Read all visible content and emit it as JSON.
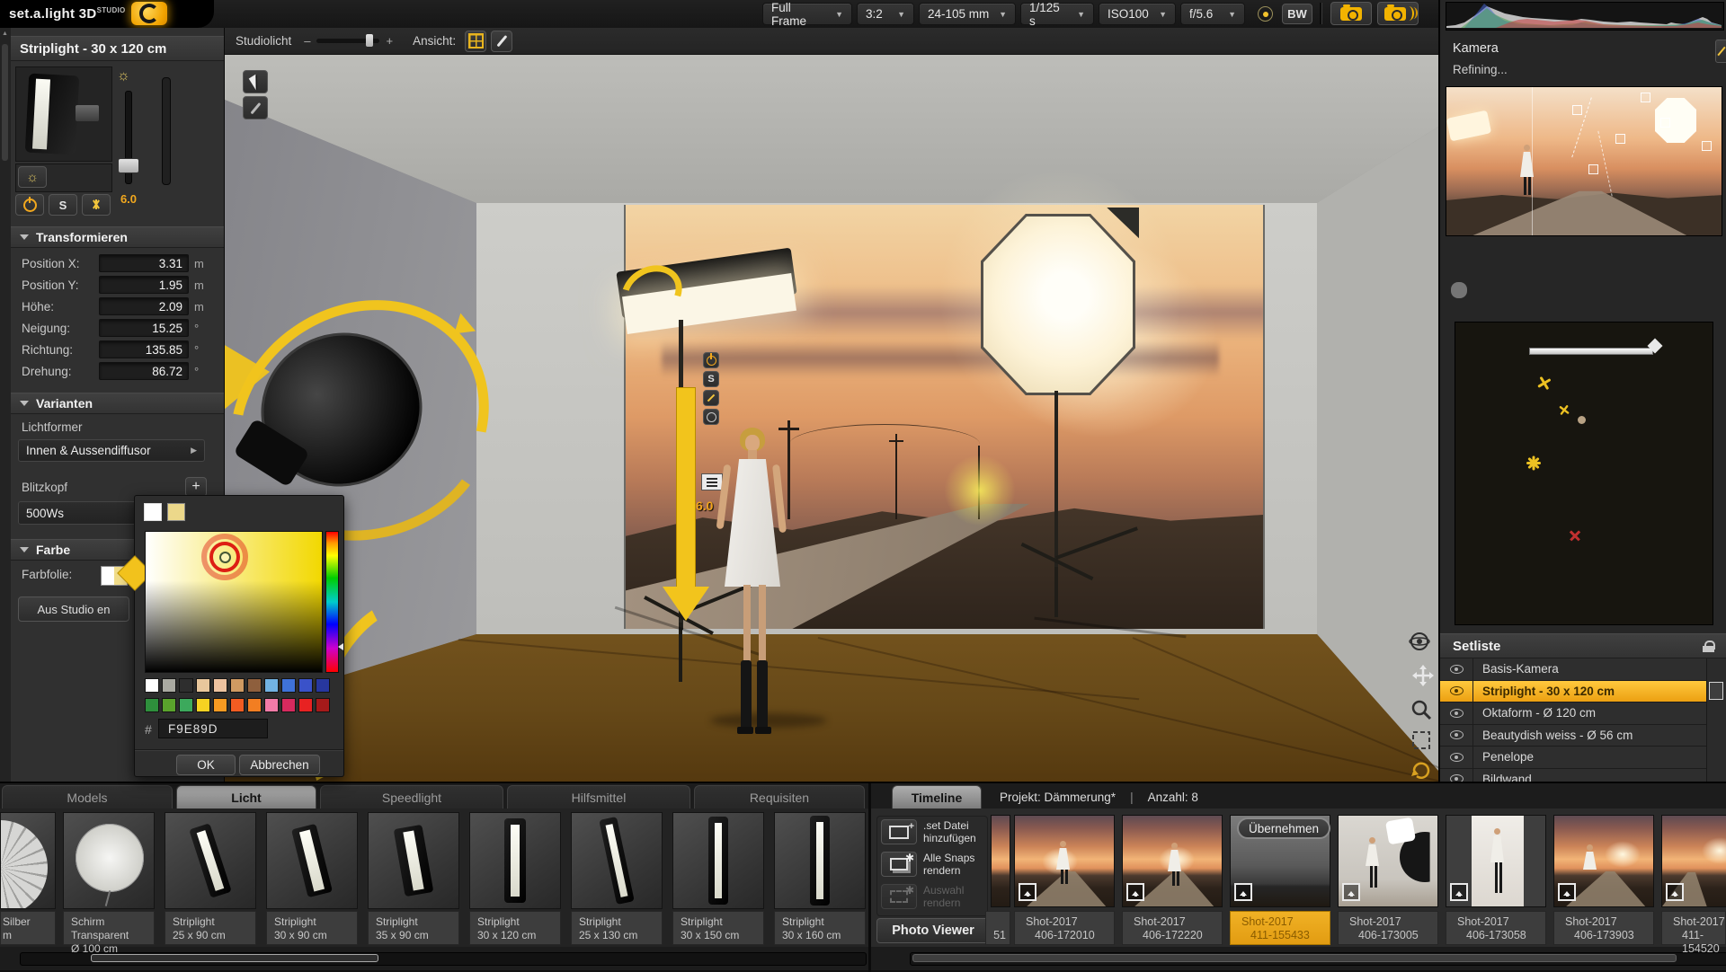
{
  "app": {
    "logo_main": "set.a.light",
    "logo_3d": "3D",
    "logo_studio": "STUDIO"
  },
  "toolbar": {
    "full_frame": "Full Frame",
    "aspect": "3:2",
    "lens": "24-105 mm",
    "shutter": "1/125 s",
    "iso": "ISO100",
    "aperture": "f/5.6",
    "bw": "BW"
  },
  "light_panel": {
    "title": "Striplight - 30 x 120 cm",
    "s_button": "S",
    "intensity": "6.0",
    "transform": {
      "header": "Transformieren",
      "rows": [
        {
          "label": "Position X:",
          "value": "3.31",
          "unit": "m"
        },
        {
          "label": "Position Y:",
          "value": "1.95",
          "unit": "m"
        },
        {
          "label": "Höhe:",
          "value": "2.09",
          "unit": "m"
        },
        {
          "label": "Neigung:",
          "value": "15.25",
          "unit": "°"
        },
        {
          "label": "Richtung:",
          "value": "135.85",
          "unit": "°"
        },
        {
          "label": "Drehung:",
          "value": "86.72",
          "unit": "°"
        }
      ]
    },
    "varianten": {
      "header": "Varianten",
      "lichtformer_label": "Lichtformer",
      "lichtformer_value": "Innen & Aussendiffusor",
      "blitzkopf_label": "Blitzkopf",
      "blitzkopf_value": "500Ws",
      "add_button": "+"
    },
    "farbe": {
      "header": "Farbe",
      "farbfolie_label": "Farbfolie:",
      "remove_button": "Aus Studio en"
    }
  },
  "color_picker": {
    "hash": "#",
    "hex": "F9E89D",
    "ok": "OK",
    "cancel": "Abbrechen",
    "presets_row1": [
      "#ffffff",
      "#a9a9a1",
      "#2e2e2e",
      "#e9c79c",
      "#eec3a0",
      "#cf9a62",
      "#8e5f3d",
      "#72b2e2",
      "#3f72d8",
      "#3a52c9",
      "#27379e"
    ],
    "presets_row2": [
      "#2e8f3c",
      "#5aa32c",
      "#3ca95c",
      "#f6d222",
      "#f69a22",
      "#f25c22",
      "#f27e22",
      "#f27ba8",
      "#d62a5e",
      "#e82222",
      "#a61a1a"
    ]
  },
  "viewport": {
    "studiolicht_label": "Studiolicht",
    "slider_minus": "–",
    "slider_plus": "+",
    "ansicht_label": "Ansicht:",
    "light_energy": "6.0",
    "s_chip": "S"
  },
  "camera_panel": {
    "title": "Kamera",
    "status": "Refining..."
  },
  "setliste": {
    "header": "Setliste",
    "items": [
      {
        "label": "Basis-Kamera"
      },
      {
        "label": "Striplight - 30 x 120 cm"
      },
      {
        "label": "Oktaform - Ø 120 cm"
      },
      {
        "label": "Beautydish weiss - Ø 56 cm"
      },
      {
        "label": "Penelope"
      },
      {
        "label": "Bildwand"
      }
    ]
  },
  "bottom_tabs": {
    "tabs": [
      "Models",
      "Licht",
      "Speedlight",
      "Hilfsmittel",
      "Requisiten"
    ]
  },
  "light_browser": {
    "items": [
      {
        "line1": "Silber",
        "line2": "m"
      },
      {
        "line1": "Schirm Transparent",
        "line2": "Ø 100 cm"
      },
      {
        "line1": "Striplight",
        "line2": "25 x 90 cm"
      },
      {
        "line1": "Striplight",
        "line2": "30 x 90 cm"
      },
      {
        "line1": "Striplight",
        "line2": "35 x 90 cm"
      },
      {
        "line1": "Striplight",
        "line2": "30 x 120 cm"
      },
      {
        "line1": "Striplight",
        "line2": "25 x 130 cm"
      },
      {
        "line1": "Striplight",
        "line2": "30 x 150 cm"
      },
      {
        "line1": "Striplight",
        "line2": "30 x 160 cm"
      }
    ]
  },
  "timeline": {
    "tab": "Timeline",
    "project": "Projekt: Dämmerung*",
    "separator": "|",
    "count": "Anzahl: 8",
    "add_set": ".set Datei hinzufügen",
    "render_all": "Alle Snaps rendern",
    "render_selection": "Auswahl rendern",
    "photo_viewer": "Photo Viewer",
    "apply": "Übernehmen",
    "partial_label": "51",
    "shots": [
      {
        "name": "Shot-2017",
        "id": "406-172010"
      },
      {
        "name": "Shot-2017",
        "id": "406-172220"
      },
      {
        "name": "Shot-2017",
        "id": "411-155433"
      },
      {
        "name": "Shot-2017",
        "id": "406-173005"
      },
      {
        "name": "Shot-2017",
        "id": "406-173058"
      },
      {
        "name": "Shot-2017",
        "id": "406-173903"
      },
      {
        "name": "Shot-2017",
        "id": "411-154520"
      }
    ]
  },
  "colors": {
    "accent": "#f2a81e",
    "selection_yellow": "#eca011",
    "gizmo_yellow": "#f0c41e",
    "picked_hex": "#F9E89D"
  }
}
